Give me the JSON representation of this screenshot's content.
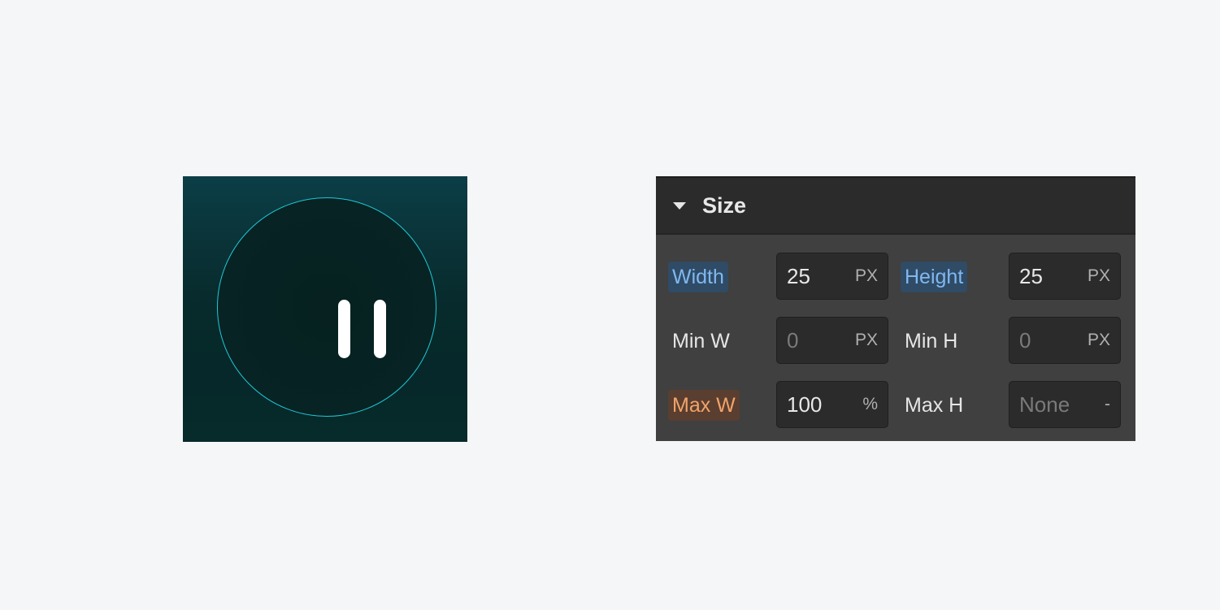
{
  "player": {
    "icon": "pause-icon",
    "ring_color": "#1ec9d6"
  },
  "panel": {
    "title": "Size",
    "collapse_icon": "caret-down-icon",
    "fields": [
      {
        "label": "Width",
        "value": "25",
        "unit": "PX",
        "state": "set",
        "highlight": "#80b8f0"
      },
      {
        "label": "Height",
        "value": "25",
        "unit": "PX",
        "state": "set",
        "highlight": "#80b8f0"
      },
      {
        "label": "Min W",
        "value": "0",
        "unit": "PX",
        "state": "default"
      },
      {
        "label": "Min H",
        "value": "0",
        "unit": "PX",
        "state": "default"
      },
      {
        "label": "Max W",
        "value": "100",
        "unit": "%",
        "state": "inherited",
        "highlight": "#f2a468"
      },
      {
        "label": "Max H",
        "value": "None",
        "unit": "-",
        "state": "default"
      }
    ]
  }
}
